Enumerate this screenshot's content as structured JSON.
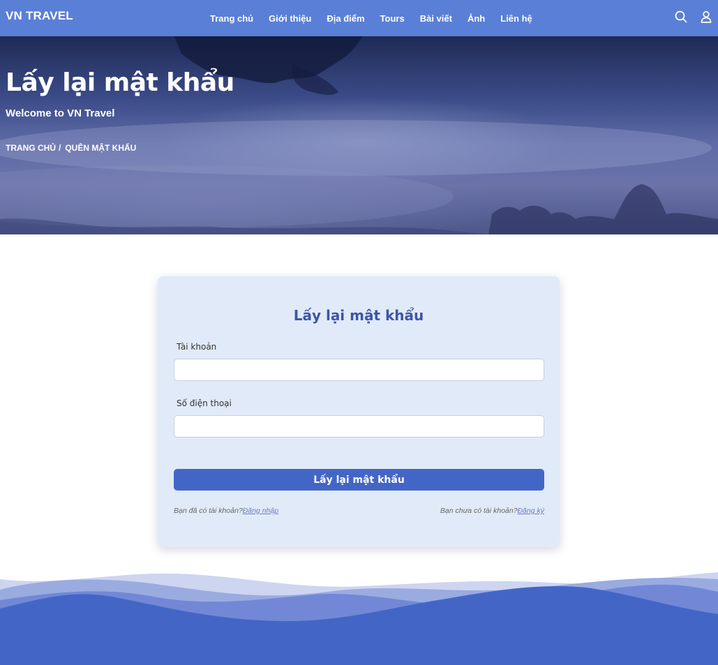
{
  "navbar": {
    "brand": "VN TRAVEL",
    "links": [
      "Trang chủ",
      "Giới thiệu",
      "Địa điểm",
      "Tours",
      "Bài viết",
      "Ảnh",
      "Liên hệ"
    ],
    "icons": [
      "search-icon",
      "user-icon"
    ]
  },
  "hero": {
    "title": "Lấy lại mật khẩu",
    "subtitle": "Welcome to VN Travel",
    "breadcrumb": {
      "home": "TRANG CHỦ",
      "separator": "/",
      "current": "QUÊN MẬT KHẨU"
    }
  },
  "form": {
    "title": "Lấy lại mật khẩu",
    "account_label": "Tài khoản",
    "account_value": "",
    "phone_label": "Số điện thoại",
    "phone_value": "",
    "submit_label": "Lấy lại mật khẩu",
    "footer_left_text": "Bạn đã có tài khoản?",
    "footer_left_link": "Đăng nhập",
    "footer_right_text": "Bạn chưa có tài khoản?",
    "footer_right_link": "Đăng ký"
  },
  "colors": {
    "navbar": "#5a7fd6",
    "primary": "#4366c6",
    "card_bg": "#e1eaf8",
    "title": "#3c56a6"
  }
}
